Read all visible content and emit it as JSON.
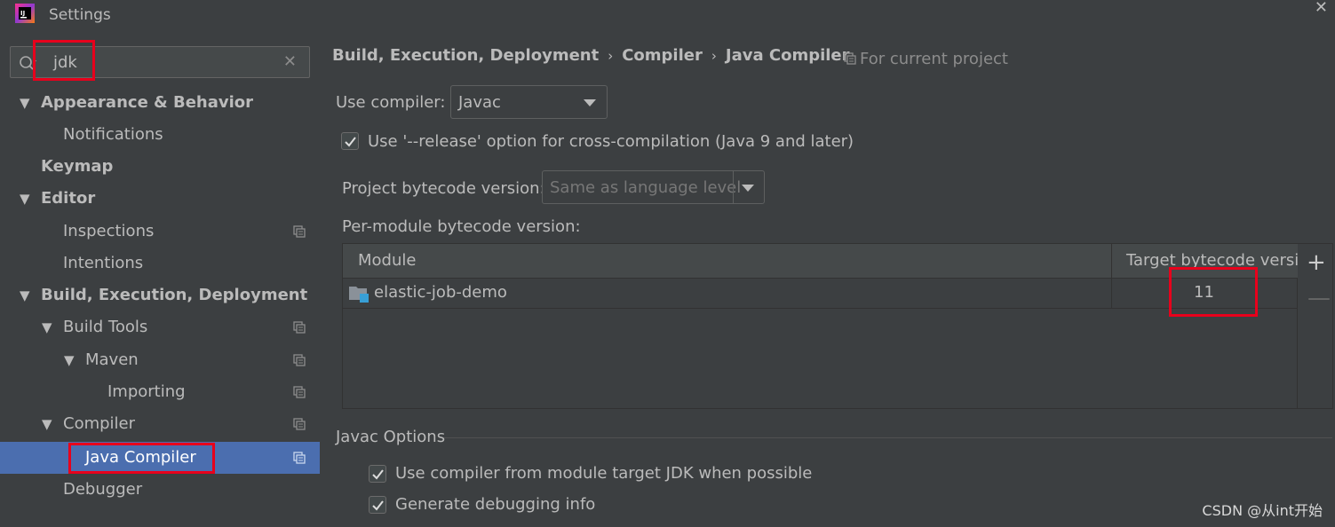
{
  "window": {
    "title": "Settings",
    "close_glyph": "✕"
  },
  "sidebar": {
    "search": {
      "value": "jdk",
      "clear_glyph": "✕"
    },
    "items": [
      {
        "label": "Appearance & Behavior",
        "expanded": true,
        "bold": true
      },
      {
        "label": "Notifications"
      },
      {
        "label": "Keymap",
        "bold": true
      },
      {
        "label": "Editor",
        "expanded": true,
        "bold": true
      },
      {
        "label": "Inspections",
        "project_icon": true
      },
      {
        "label": "Intentions"
      },
      {
        "label": "Build, Execution, Deployment",
        "expanded": true,
        "bold": true
      },
      {
        "label": "Build Tools",
        "expanded": true,
        "project_icon": true
      },
      {
        "label": "Maven",
        "expanded": true,
        "project_icon": true
      },
      {
        "label": "Importing",
        "project_icon": true
      },
      {
        "label": "Compiler",
        "expanded": true,
        "project_icon": true
      },
      {
        "label": "Java Compiler",
        "selected": true,
        "project_icon": true
      },
      {
        "label": "Debugger"
      }
    ]
  },
  "main": {
    "breadcrumb": [
      "Build, Execution, Deployment",
      "Compiler",
      "Java Compiler"
    ],
    "breadcrumb_sep": "›",
    "scope_label": "For current project",
    "use_compiler_label": "Use compiler:",
    "use_compiler_value": "Javac",
    "release_option": {
      "checked": true,
      "label": "Use '--release' option for cross-compilation (Java 9 and later)"
    },
    "project_bytecode_label": "Project bytecode version:",
    "project_bytecode_value": "Same as language level",
    "per_module_label": "Per-module bytecode version:",
    "table": {
      "columns": [
        "Module",
        "Target bytecode versi..."
      ],
      "rows": [
        {
          "module": "elastic-job-demo",
          "target": "11"
        }
      ],
      "add_glyph": "+",
      "remove_glyph": "—"
    },
    "javac_section": "Javac Options",
    "javac_options": [
      {
        "checked": true,
        "label": "Use compiler from module target JDK when possible"
      },
      {
        "checked": true,
        "label": "Generate debugging info"
      }
    ]
  },
  "watermark": "CSDN @从int开始",
  "colors": {
    "background": "#3c3f41",
    "selection": "#4b6eaf",
    "highlight_box": "#e8001c",
    "text": "#bbbbbb"
  }
}
